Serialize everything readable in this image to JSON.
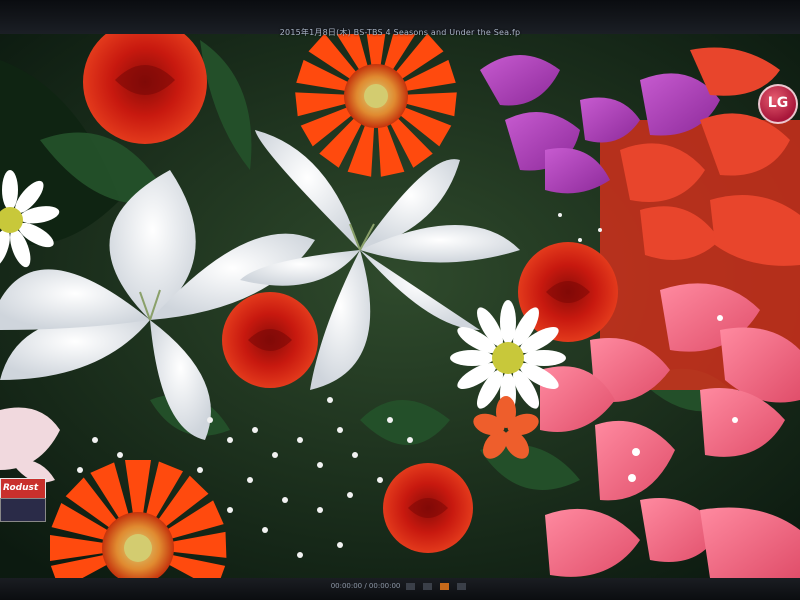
{
  "broadcast": {
    "title_line": "2015年1月8日(木) BS-TBS 4 Seasons and Under the Sea.fp",
    "channel_logo": "LG",
    "corner_tag": "Rodust",
    "player_status": "00:00:00 / 00:00:00"
  },
  "colors": {
    "gerbera_orange": "#ff4a0e",
    "rose_red": "#c41410",
    "lily_white": "#f3f4f6",
    "bougainvillea_pink": "#f06a86",
    "bougainvillea_magenta": "#b43bb6",
    "leaf_green": "#24512a"
  },
  "icons": {
    "logo": "lg-logo-icon",
    "controls": [
      "rewind-icon",
      "play-icon",
      "pause-icon",
      "forward-icon"
    ]
  }
}
